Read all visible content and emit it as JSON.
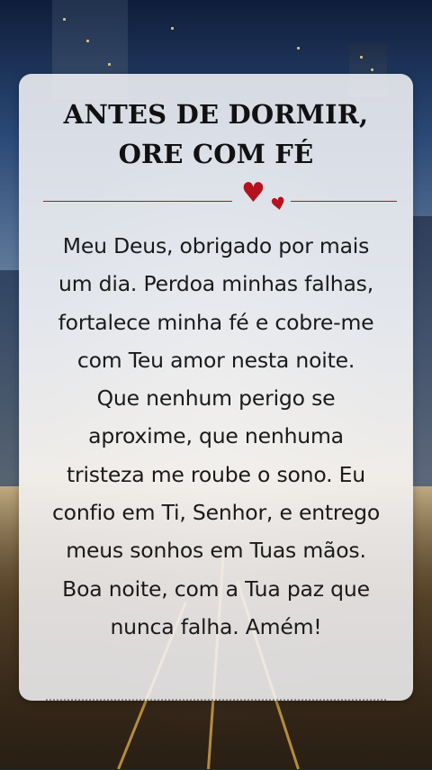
{
  "card": {
    "title_lines": [
      "ANTES DE DORMIR,",
      "ORE COM FÉ"
    ],
    "divider_icon": "hearts-icon",
    "accent_color": "#b5121f",
    "prayer_lines": [
      "Meu Deus, obrigado por mais",
      "um dia. Perdoa minhas falhas,",
      "fortalece minha fé e cobre-me",
      "com Teu amor nesta noite.",
      "Que nenhum perigo se",
      "aproxime, que nenhuma",
      "tristeza me roube o sono. Eu",
      "confio em Ti, Senhor, e entrego",
      "meus sonhos em Tuas mãos.",
      "Boa noite, com a Tua paz que",
      "nunca falha. Amém!"
    ]
  }
}
